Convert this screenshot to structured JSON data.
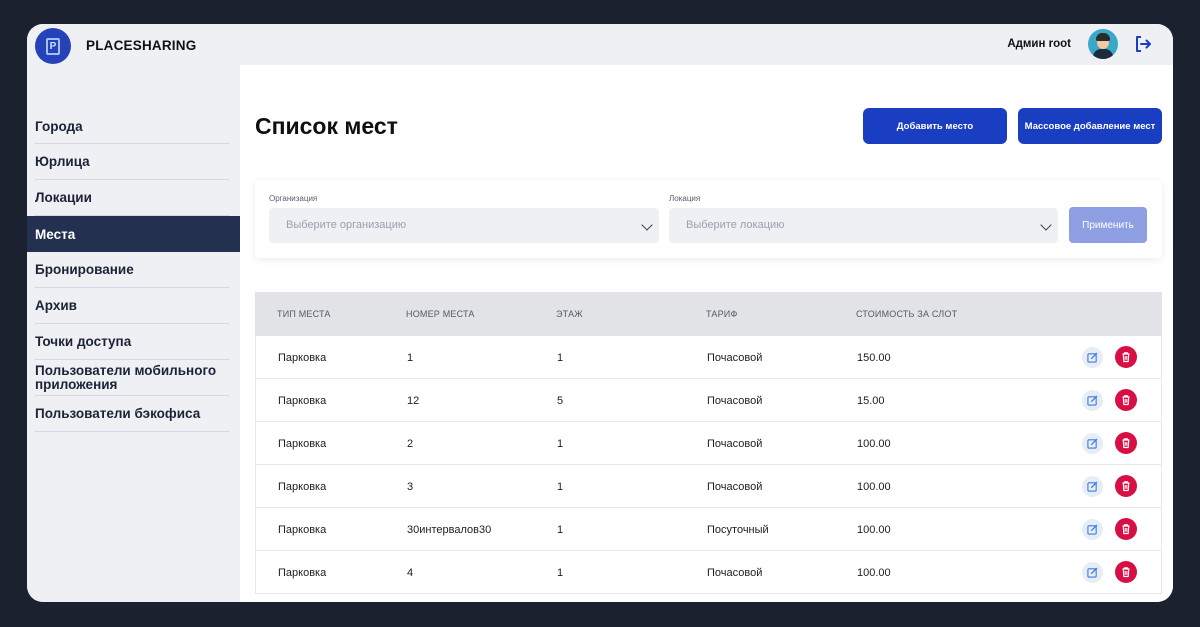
{
  "header": {
    "brand": "PLACESHARING",
    "user_name": "Админ root"
  },
  "sidebar": {
    "items": [
      {
        "label": "Города",
        "active": false
      },
      {
        "label": "Юрлица",
        "active": false
      },
      {
        "label": "Локации",
        "active": false
      },
      {
        "label": "Места",
        "active": true
      },
      {
        "label": "Бронирование",
        "active": false
      },
      {
        "label": "Архив",
        "active": false
      },
      {
        "label": "Точки доступа",
        "active": false
      },
      {
        "label": "Пользователи мобильного приложения",
        "active": false
      },
      {
        "label": "Пользователи бэкофиса",
        "active": false
      }
    ]
  },
  "main": {
    "title": "Список мест",
    "add_button": "Добавить место",
    "bulk_add_button": "Массовое добавление мест"
  },
  "filters": {
    "organization_label": "Организация",
    "organization_placeholder": "Выберите организацию",
    "location_label": "Локация",
    "location_placeholder": "Выберите локацию",
    "apply_button": "Применить"
  },
  "table": {
    "columns": [
      "ТИП МЕСТА",
      "НОМЕР МЕСТА",
      "ЭТАЖ",
      "ТАРИФ",
      "СТОИМОСТЬ ЗА СЛОТ"
    ],
    "rows": [
      [
        "Парковка",
        "1",
        "1",
        "Почасовой",
        "150.00"
      ],
      [
        "Парковка",
        "12",
        "5",
        "Почасовой",
        "15.00"
      ],
      [
        "Парковка",
        "2",
        "1",
        "Почасовой",
        "100.00"
      ],
      [
        "Парковка",
        "3",
        "1",
        "Почасовой",
        "100.00"
      ],
      [
        "Парковка",
        "30интервалов30",
        "1",
        "Посуточный",
        "100.00"
      ],
      [
        "Парковка",
        "4",
        "1",
        "Почасовой",
        "100.00"
      ]
    ]
  },
  "colors": {
    "primary": "#1a3ec2",
    "sidebar_active": "#24304f",
    "delete": "#d80f45",
    "apply_disabled": "#8ea0e3"
  },
  "icons": {
    "logo": "parking-logo-icon",
    "avatar": "user-avatar",
    "logout": "logout-icon",
    "edit": "edit-icon",
    "delete": "trash-icon",
    "dropdown": "chevron-down-icon"
  }
}
